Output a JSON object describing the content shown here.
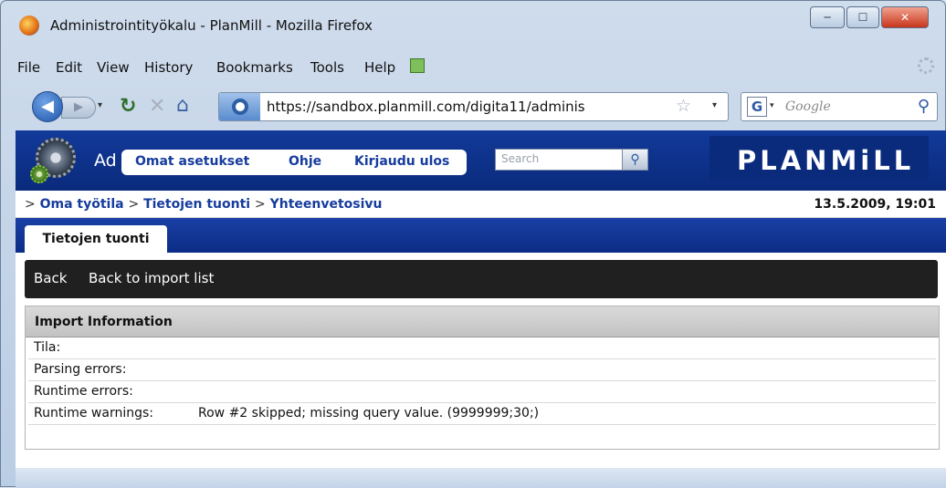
{
  "window": {
    "title": "Administrointityökalu - PlanMill - Mozilla Firefox",
    "minimize_glyph": "─",
    "maximize_glyph": "☐",
    "close_glyph": "✕"
  },
  "menubar": {
    "items": [
      "File",
      "Edit",
      "View",
      "History",
      "Bookmarks",
      "Tools",
      "Help"
    ]
  },
  "toolbar": {
    "back_glyph": "◀",
    "forward_glyph": "▶",
    "dropdown_glyph": "▾",
    "reload_glyph": "↻",
    "stop_glyph": "✕",
    "home_glyph": "⌂",
    "url": "https://sandbox.planmill.com/digita11/adminis",
    "star_glyph": "☆",
    "search_engine": "G",
    "search_placeholder": "Google",
    "search_glyph": "⚲"
  },
  "page": {
    "app_title": "Ad",
    "top_links": [
      "Omat asetukset",
      "Ohje",
      "Kirjaudu ulos"
    ],
    "search_placeholder": "Search",
    "search_glyph": "⚲",
    "logo_text": "PLANMiLL",
    "breadcrumb": {
      "prefix": ">",
      "items": [
        "Oma työtila",
        "Tietojen tuonti",
        "Yhteenvetosivu"
      ],
      "separator": ">"
    },
    "datetime": "13.5.2009, 19:01",
    "tab": "Tietojen tuonti",
    "actions": [
      "Back",
      "Back to import list"
    ],
    "panel": {
      "title": "Import Information",
      "rows": [
        {
          "label": "Tila:",
          "value": ""
        },
        {
          "label": "Parsing errors:",
          "value": ""
        },
        {
          "label": "Runtime errors:",
          "value": ""
        },
        {
          "label": "Runtime warnings:",
          "value": "Row #2 skipped; missing query value. (9999999;30;)"
        }
      ]
    }
  },
  "colors": {
    "planmill_blue": "#0b2d86",
    "link_blue": "#163c9d",
    "action_bar": "#202020"
  }
}
